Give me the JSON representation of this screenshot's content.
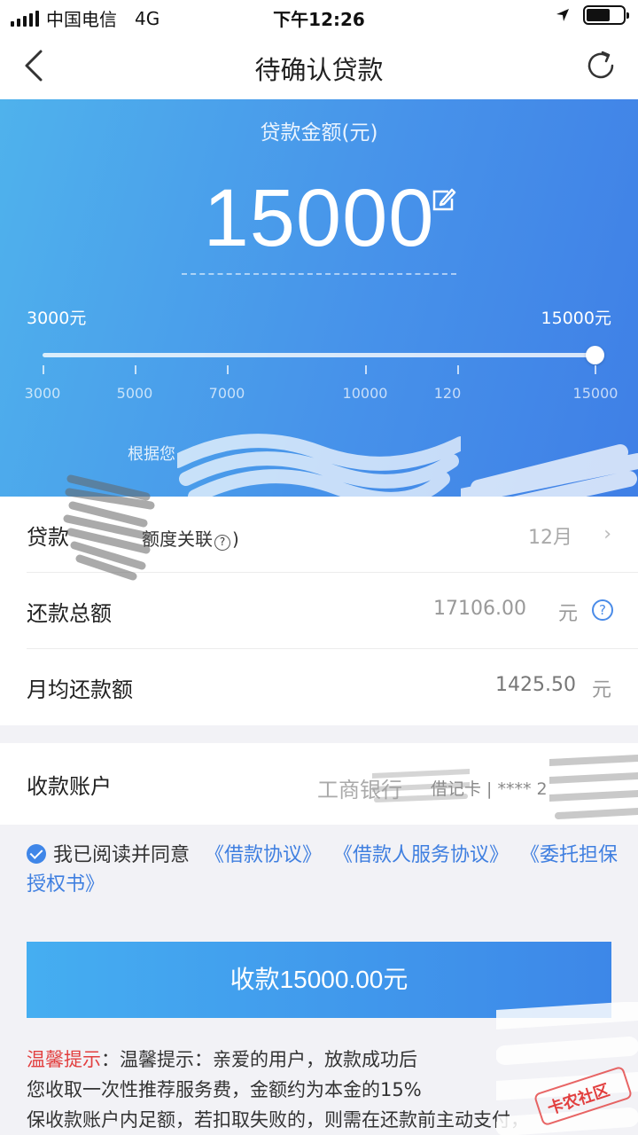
{
  "status_bar": {
    "carrier": "中国电信",
    "network": "4G",
    "time": "下午12:26"
  },
  "nav": {
    "title": "待确认贷款"
  },
  "loan": {
    "amount_label": "贷款金额(元)",
    "amount": "15000",
    "min_label": "3000元",
    "max_label": "15000元",
    "slider_value": 15000,
    "ticks": [
      "3000",
      "5000",
      "7000",
      "10000",
      "120",
      "15000"
    ],
    "tip": "根据您"
  },
  "details": {
    "term_label": "贷款",
    "term_note": "额度关联",
    "term_value": "12月",
    "total_label": "还款总额",
    "total_value": "17106.00",
    "total_unit": "元",
    "monthly_label": "月均还款额",
    "monthly_value": "1425.50",
    "monthly_unit": "元"
  },
  "account": {
    "label": "收款账户",
    "bank": "工商银行",
    "card_type": "借记卡 | **** 2"
  },
  "agreement": {
    "prefix": "我已阅读并同意",
    "link1": "《借款协议》",
    "link2": "《借款人服务协议》",
    "link3": "《委托担保授权书》"
  },
  "submit": {
    "label": "收款15000.00元"
  },
  "notice": {
    "title": "温馨提示",
    "line1": "：温馨提示：亲爱的用户，放款成功后",
    "line2": "您收取一次性推荐服务费，金额约为本金的15%",
    "line3": "保收款账户内足额，若扣取失败的，则需在还款前主动支付，"
  },
  "watermark": {
    "text": "卡农社区"
  },
  "colors": {
    "primary": "#3f86e8",
    "hero_start": "#4fb2ec",
    "hero_end": "#3f7fe6",
    "warning": "#e23f3f"
  }
}
